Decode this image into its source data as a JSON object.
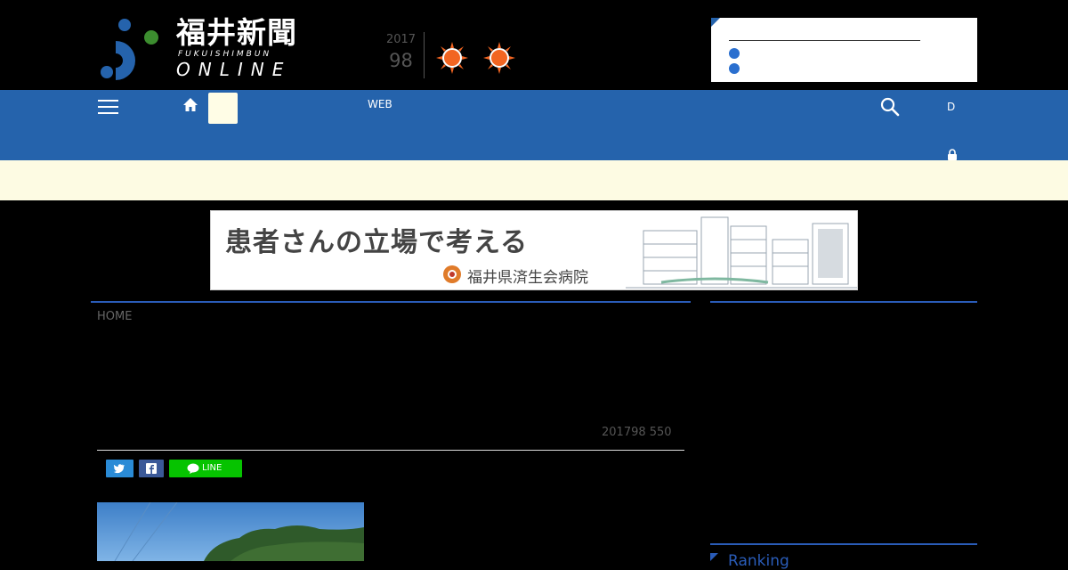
{
  "header": {
    "logo_kanji": "福井新聞",
    "logo_romaji": "FUKUISHIMBUN",
    "logo_online": "ONLINE",
    "date_year": "2017",
    "date_md": "98",
    "weather_icons": [
      "sun-icon",
      "sun-icon"
    ],
    "notice_items": [
      "",
      ""
    ]
  },
  "nav": {
    "web_label": "WEB",
    "right_label": "D"
  },
  "ad": {
    "headline": "患者さんの立場で考える",
    "org": "福井県済生会病院"
  },
  "main": {
    "breadcrumb": "HOME",
    "article_date": "201798 550",
    "share": {
      "line_label": "LINE"
    }
  },
  "sidebar": {
    "ranking_title": "Ranking"
  },
  "colors": {
    "nav_blue": "#2563ac",
    "accent_blue": "#2a5cb8",
    "sun_orange": "#f26522",
    "band_yellow": "#fdfbe3"
  }
}
